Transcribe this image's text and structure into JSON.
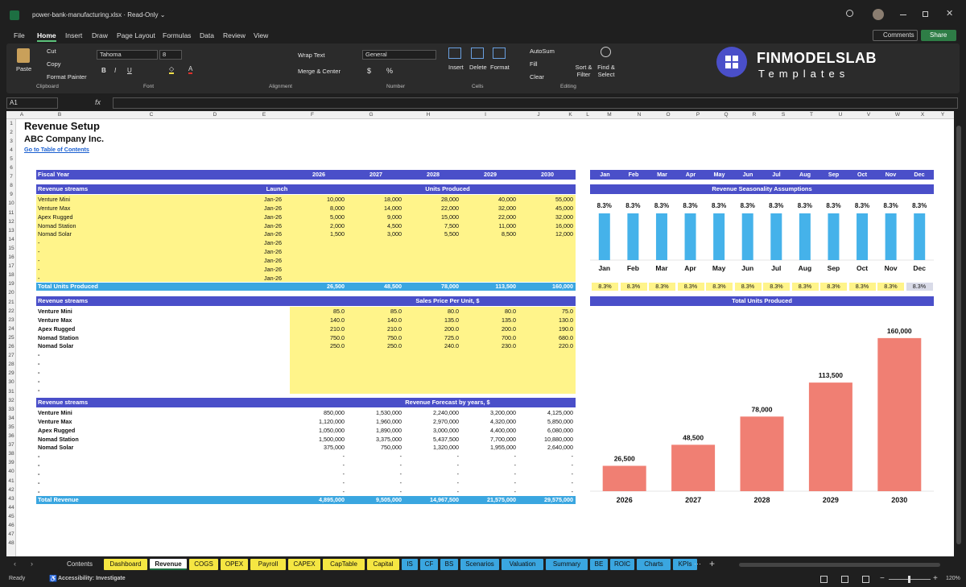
{
  "window": {
    "title": "power-bank-manufacturing.xlsx  ·  Read-Only ⌄"
  },
  "menu": [
    "File",
    "Home",
    "Insert",
    "Draw",
    "Page Layout",
    "Formulas",
    "Data",
    "Review",
    "View"
  ],
  "top_buttons": {
    "comments": "Comments",
    "share": "Share"
  },
  "ribbon": {
    "paste": "Paste",
    "cut": "Cut",
    "copy": "Copy",
    "format_painter": "Format Painter",
    "clipboard": "Clipboard",
    "font_name": "Tahoma",
    "font_size": "8",
    "font": "Font",
    "wrap_text": "Wrap Text",
    "merge_center": "Merge & Center",
    "alignment": "Alignment",
    "number_format": "General",
    "number": "Number",
    "insert": "Insert",
    "delete": "Delete",
    "format": "Format",
    "cells": "Cells",
    "autosum": "AutoSum",
    "fill": "Fill",
    "clear": "Clear",
    "sort_filter": "Sort & Filter",
    "find_select": "Find & Select",
    "editing": "Editing"
  },
  "logo": {
    "line1": "FINMODELSLAB",
    "line2": "Templates"
  },
  "formula_bar": {
    "name_box": "A1",
    "formula": ""
  },
  "columns": [
    "A",
    "B",
    "C",
    "D",
    "E",
    "F",
    "G",
    "H",
    "I",
    "J",
    "K",
    "L",
    "M",
    "N",
    "O",
    "P",
    "Q",
    "R",
    "S",
    "T",
    "U",
    "V",
    "W",
    "X",
    "Y"
  ],
  "rows": [
    "1",
    "2",
    "3",
    "4",
    "5",
    "6",
    "7",
    "8",
    "9",
    "10",
    "11",
    "12",
    "13",
    "14",
    "15",
    "16",
    "17",
    "18",
    "19",
    "20",
    "21",
    "22",
    "23",
    "24",
    "25",
    "26",
    "27",
    "28",
    "29",
    "30",
    "31",
    "32",
    "33",
    "34",
    "35",
    "36",
    "37",
    "38",
    "39",
    "40",
    "41",
    "42",
    "43",
    "44",
    "45",
    "46",
    "47",
    "48"
  ],
  "sheet": {
    "title": "Revenue Setup",
    "company": "ABC Company Inc.",
    "toc_link": "Go to Table of Contents",
    "fiscal_year": "Fiscal Year",
    "years": [
      "2026",
      "2027",
      "2028",
      "2029",
      "2030"
    ],
    "months": [
      "Jan",
      "Feb",
      "Mar",
      "Apr",
      "May",
      "Jun",
      "Jul",
      "Aug",
      "Sep",
      "Oct",
      "Nov",
      "Dec"
    ],
    "units_block": {
      "header": "Revenue streams",
      "launch": "Launch",
      "title": "Units Produced",
      "rows": [
        {
          "name": "Venture Mini",
          "launch": "Jan-26",
          "values": [
            "10,000",
            "18,000",
            "28,000",
            "40,000",
            "55,000"
          ]
        },
        {
          "name": "Venture Max",
          "launch": "Jan-26",
          "values": [
            "8,000",
            "14,000",
            "22,000",
            "32,000",
            "45,000"
          ]
        },
        {
          "name": "Apex Rugged",
          "launch": "Jan-26",
          "values": [
            "5,000",
            "9,000",
            "15,000",
            "22,000",
            "32,000"
          ]
        },
        {
          "name": "Nomad Station",
          "launch": "Jan-26",
          "values": [
            "2,000",
            "4,500",
            "7,500",
            "11,000",
            "16,000"
          ]
        },
        {
          "name": "Nomad Solar",
          "launch": "Jan-26",
          "values": [
            "1,500",
            "3,000",
            "5,500",
            "8,500",
            "12,000"
          ]
        },
        {
          "name": "-",
          "launch": "Jan-26",
          "values": [
            "",
            "",
            "",
            "",
            ""
          ]
        },
        {
          "name": "-",
          "launch": "Jan-26",
          "values": [
            "",
            "",
            "",
            "",
            ""
          ]
        },
        {
          "name": "-",
          "launch": "Jan-26",
          "values": [
            "",
            "",
            "",
            "",
            ""
          ]
        },
        {
          "name": "-",
          "launch": "Jan-26",
          "values": [
            "",
            "",
            "",
            "",
            ""
          ]
        },
        {
          "name": "-",
          "launch": "Jan-26",
          "values": [
            "",
            "",
            "",
            "",
            ""
          ]
        }
      ],
      "total_label": "Total Units Produced",
      "totals": [
        "26,500",
        "48,500",
        "78,000",
        "113,500",
        "160,000"
      ]
    },
    "price_block": {
      "header": "Revenue streams",
      "title": "Sales Price Per Unit, $",
      "rows": [
        {
          "name": "Venture Mini",
          "values": [
            "85.0",
            "85.0",
            "80.0",
            "80.0",
            "75.0"
          ]
        },
        {
          "name": "Venture Max",
          "values": [
            "140.0",
            "140.0",
            "135.0",
            "135.0",
            "130.0"
          ]
        },
        {
          "name": "Apex Rugged",
          "values": [
            "210.0",
            "210.0",
            "200.0",
            "200.0",
            "190.0"
          ]
        },
        {
          "name": "Nomad Station",
          "values": [
            "750.0",
            "750.0",
            "725.0",
            "700.0",
            "680.0"
          ]
        },
        {
          "name": "Nomad Solar",
          "values": [
            "250.0",
            "250.0",
            "240.0",
            "230.0",
            "220.0"
          ]
        },
        {
          "name": "-",
          "values": [
            "",
            "",
            "",
            "",
            ""
          ]
        },
        {
          "name": "-",
          "values": [
            "",
            "",
            "",
            "",
            ""
          ]
        },
        {
          "name": "-",
          "values": [
            "",
            "",
            "",
            "",
            ""
          ]
        },
        {
          "name": "-",
          "values": [
            "",
            "",
            "",
            "",
            ""
          ]
        },
        {
          "name": "-",
          "values": [
            "",
            "",
            "",
            "",
            ""
          ]
        }
      ]
    },
    "revenue_block": {
      "header": "Revenue streams",
      "title": "Revenue Forecast by years, $",
      "rows": [
        {
          "name": "Venture Mini",
          "values": [
            "850,000",
            "1,530,000",
            "2,240,000",
            "3,200,000",
            "4,125,000"
          ]
        },
        {
          "name": "Venture Max",
          "values": [
            "1,120,000",
            "1,960,000",
            "2,970,000",
            "4,320,000",
            "5,850,000"
          ]
        },
        {
          "name": "Apex Rugged",
          "values": [
            "1,050,000",
            "1,890,000",
            "3,000,000",
            "4,400,000",
            "6,080,000"
          ]
        },
        {
          "name": "Nomad Station",
          "values": [
            "1,500,000",
            "3,375,000",
            "5,437,500",
            "7,700,000",
            "10,880,000"
          ]
        },
        {
          "name": "Nomad Solar",
          "values": [
            "375,000",
            "750,000",
            "1,320,000",
            "1,955,000",
            "2,640,000"
          ]
        },
        {
          "name": "-",
          "values": [
            "-",
            "-",
            "-",
            "-",
            "-"
          ]
        },
        {
          "name": "-",
          "values": [
            "-",
            "-",
            "-",
            "-",
            "-"
          ]
        },
        {
          "name": "-",
          "values": [
            "-",
            "-",
            "-",
            "-",
            "-"
          ]
        },
        {
          "name": "-",
          "values": [
            "-",
            "-",
            "-",
            "-",
            "-"
          ]
        },
        {
          "name": "-",
          "values": [
            "-",
            "-",
            "-",
            "-",
            "-"
          ]
        }
      ],
      "total_label": "Total Revenue",
      "totals": [
        "4,895,000",
        "9,505,000",
        "14,967,500",
        "21,575,000",
        "29,575,000"
      ]
    },
    "seasonality_title": "Revenue Seasonality Assumptions",
    "seasonality_values": [
      "8.3%",
      "8.3%",
      "8.3%",
      "8.3%",
      "8.3%",
      "8.3%",
      "8.3%",
      "8.3%",
      "8.3%",
      "8.3%",
      "8.3%",
      "8.3%"
    ],
    "units_chart_title": "Total Units Produced"
  },
  "chart_data": [
    {
      "type": "bar",
      "title": "",
      "categories": [
        "Jan",
        "Feb",
        "Mar",
        "Apr",
        "May",
        "Jun",
        "Jul",
        "Aug",
        "Sep",
        "Oct",
        "Nov",
        "Dec"
      ],
      "values": [
        8.3,
        8.3,
        8.3,
        8.3,
        8.3,
        8.3,
        8.3,
        8.3,
        8.3,
        8.3,
        8.3,
        8.3
      ],
      "data_labels": [
        "8.3%",
        "8.3%",
        "8.3%",
        "8.3%",
        "8.3%",
        "8.3%",
        "8.3%",
        "8.3%",
        "8.3%",
        "8.3%",
        "8.3%",
        "8.3%"
      ],
      "color": "#45b2ea",
      "ylim": [
        0,
        8.3
      ]
    },
    {
      "type": "bar",
      "title": "",
      "categories": [
        "2026",
        "2027",
        "2028",
        "2029",
        "2030"
      ],
      "values": [
        26500,
        48500,
        78000,
        113500,
        160000
      ],
      "data_labels": [
        "26,500",
        "48,500",
        "78,000",
        "113,500",
        "160,000"
      ],
      "color": "#f07f73",
      "ylim": [
        0,
        170000
      ]
    }
  ],
  "tabs": [
    {
      "label": "Contents",
      "color": "#1f1f1f",
      "text": "#ddd"
    },
    {
      "label": "Dashboard",
      "color": "#f5e642",
      "text": "#111"
    },
    {
      "label": "Revenue",
      "color": "#ffffff",
      "text": "#111"
    },
    {
      "label": "COGS",
      "color": "#f5e642",
      "text": "#111"
    },
    {
      "label": "OPEX",
      "color": "#f5e642",
      "text": "#111"
    },
    {
      "label": "Payroll",
      "color": "#f5e642",
      "text": "#111"
    },
    {
      "label": "CAPEX",
      "color": "#f5e642",
      "text": "#111"
    },
    {
      "label": "CapTable",
      "color": "#f5e642",
      "text": "#111"
    },
    {
      "label": "Capital",
      "color": "#f5e642",
      "text": "#111"
    },
    {
      "label": "IS",
      "color": "#3aa6e0",
      "text": "#111"
    },
    {
      "label": "CF",
      "color": "#3aa6e0",
      "text": "#111"
    },
    {
      "label": "BS",
      "color": "#3aa6e0",
      "text": "#111"
    },
    {
      "label": "Scenarios",
      "color": "#3aa6e0",
      "text": "#111"
    },
    {
      "label": "Valuation",
      "color": "#3aa6e0",
      "text": "#111"
    },
    {
      "label": "Summary",
      "color": "#3aa6e0",
      "text": "#111"
    },
    {
      "label": "BE",
      "color": "#3aa6e0",
      "text": "#111"
    },
    {
      "label": "ROIC",
      "color": "#3aa6e0",
      "text": "#111"
    },
    {
      "label": "Charts",
      "color": "#3aa6e0",
      "text": "#111"
    },
    {
      "label": "KPIs",
      "color": "#3aa6e0",
      "text": "#111"
    }
  ],
  "status": {
    "ready": "Ready",
    "accessibility": "Accessibility: Investigate",
    "zoom": "120%"
  }
}
